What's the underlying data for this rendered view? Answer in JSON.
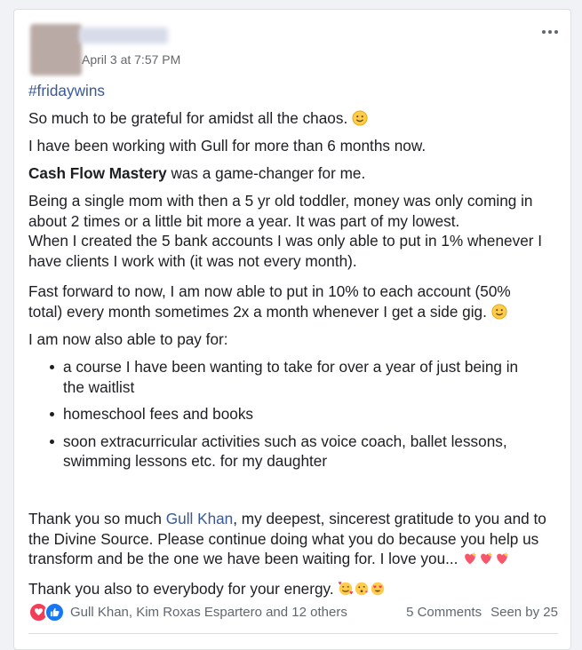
{
  "post": {
    "timestamp": "April 3 at 7:57 PM",
    "hashtag": "#fridaywins",
    "p1": "So much to be grateful for amidst all the chaos.",
    "p2": "I have been working with Gull for more than 6 months now.",
    "p3_bold": "Cash Flow Mastery",
    "p3_rest": " was a game-changer for me.",
    "p4_line1": "Being a single mom with then a 5 yr old toddler, money was only coming in",
    "p4_line2": "about 2 times or a little bit more a year.  It was part of my lowest.",
    "p4_line3": "When I created the 5 bank accounts I was only able to put in 1% whenever I",
    "p4_line4": "have clients I work with (it was not every month).",
    "p5_line1": "Fast forward to now, I am now able to put in 10% to each account (50%",
    "p5_line2": "total) every month sometimes 2x a month whenever I get a side gig.",
    "p6": "I am now also able to pay for:",
    "bullets": [
      {
        "line1": "a course I have been wanting to take for over a year of just being in",
        "line2": "the waitlist"
      },
      {
        "line1": "homeschool fees and books",
        "line2": ""
      },
      {
        "line1": "soon extracurricular activities such as voice coach, ballet lessons,",
        "line2": "swimming lessons etc. for my daughter"
      }
    ],
    "thanks_a": "Thank you so much ",
    "thanks_link": "Gull Khan",
    "thanks_b": ", my deepest, sincerest gratitude to you and to",
    "thanks_line2": "the Divine Source. Please continue doing what you do because you help us",
    "thanks_line3": "transform and be the one we have been waiting for.  I love you...",
    "thanks_everybody": "Thank you also to everybody for your energy."
  },
  "footer": {
    "reactors": "Gull Khan, Kim Roxas Espartero and 12 others",
    "comments": "5 Comments",
    "seen": "Seen by 25"
  },
  "colors": {
    "link": "#385898",
    "love": "#f33e58",
    "like": "#1877f2"
  },
  "icons": [
    "more-options-icon",
    "smile-emoji-icon",
    "sparkling-heart-emoji-icon",
    "smiling-face-with-hearts-emoji-icon",
    "face-blowing-kiss-emoji-icon",
    "heart-eyes-emoji-icon",
    "love-reaction-icon",
    "like-reaction-icon"
  ]
}
